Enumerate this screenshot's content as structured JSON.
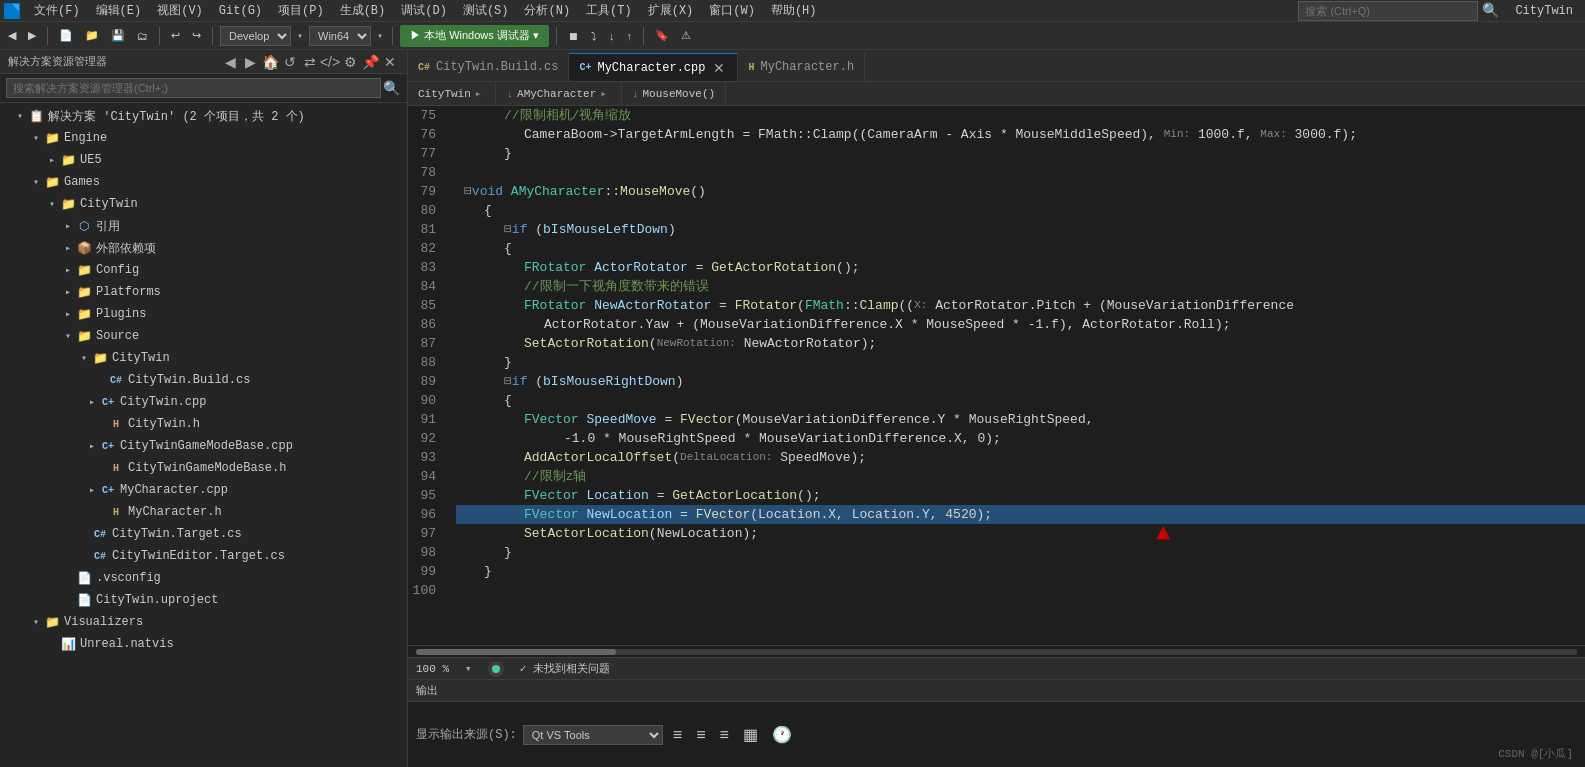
{
  "app": {
    "title": "CityTwin",
    "icon": "VS"
  },
  "menu": {
    "items": [
      "文件(F)",
      "编辑(E)",
      "视图(V)",
      "Git(G)",
      "项目(P)",
      "生成(B)",
      "调试(D)",
      "测试(S)",
      "分析(N)",
      "工具(T)",
      "扩展(X)",
      "窗口(W)",
      "帮助(H)"
    ]
  },
  "toolbar": {
    "config": "Develop▾",
    "platform": "Win64▾",
    "run_label": "▶ 本地 Windows 调试器 ▾",
    "search_placeholder": "搜索 (Ctrl+Q)"
  },
  "sidebar": {
    "title": "解决方案资源管理器",
    "search_placeholder": "搜索解决方案资源管理器(Ctrl+;)",
    "solution_label": "解决方案 'CityTwin' (2 个项目，共 2 个)",
    "tree": [
      {
        "id": "engine",
        "label": "Engine",
        "type": "folder",
        "indent": 1,
        "expanded": true
      },
      {
        "id": "ue5",
        "label": "UE5",
        "type": "folder",
        "indent": 2,
        "expanded": false
      },
      {
        "id": "games",
        "label": "Games",
        "type": "folder",
        "indent": 1,
        "expanded": true
      },
      {
        "id": "citytwin-proj",
        "label": "CityTwin",
        "type": "folder",
        "indent": 2,
        "expanded": true
      },
      {
        "id": "ref",
        "label": "引用",
        "type": "ref",
        "indent": 3,
        "expanded": false
      },
      {
        "id": "extdep",
        "label": "外部依赖项",
        "type": "extdep",
        "indent": 3,
        "expanded": false
      },
      {
        "id": "config",
        "label": "Config",
        "type": "folder",
        "indent": 3,
        "expanded": false
      },
      {
        "id": "platforms",
        "label": "Platforms",
        "type": "folder",
        "indent": 3,
        "expanded": false
      },
      {
        "id": "plugins",
        "label": "Plugins",
        "type": "folder",
        "indent": 3,
        "expanded": false
      },
      {
        "id": "source",
        "label": "Source",
        "type": "folder",
        "indent": 3,
        "expanded": true
      },
      {
        "id": "citytwin-src",
        "label": "CityTwin",
        "type": "folder",
        "indent": 4,
        "expanded": true
      },
      {
        "id": "citytwin-build",
        "label": "CityTwin.Build.cs",
        "type": "cs",
        "indent": 5
      },
      {
        "id": "citytwin-cpp",
        "label": "CityTwin.cpp",
        "type": "cpp-plus",
        "indent": 5
      },
      {
        "id": "citytwin-h",
        "label": "CityTwin.h",
        "type": "h",
        "indent": 5
      },
      {
        "id": "gamemode-cpp",
        "label": "CityTwinGameModeBase.cpp",
        "type": "cpp-plus",
        "indent": 5
      },
      {
        "id": "gamemode-h",
        "label": "CityTwinGameModeBase.h",
        "type": "h",
        "indent": 5
      },
      {
        "id": "mychar-cpp",
        "label": "MyCharacter.cpp",
        "type": "cpp-plus",
        "indent": 5
      },
      {
        "id": "mychar-h",
        "label": "MyCharacter.h",
        "type": "h",
        "indent": 5
      },
      {
        "id": "target",
        "label": "CityTwin.Target.cs",
        "type": "cs",
        "indent": 4
      },
      {
        "id": "editor-target",
        "label": "CityTwinEditor.Target.cs",
        "type": "cs",
        "indent": 4
      },
      {
        "id": "vsconfig",
        "label": ".vsconfig",
        "type": "config",
        "indent": 3
      },
      {
        "id": "uproject",
        "label": "CityTwin.uproject",
        "type": "config",
        "indent": 3
      },
      {
        "id": "visualizers",
        "label": "Visualizers",
        "type": "folder",
        "indent": 1,
        "expanded": true
      },
      {
        "id": "unreal-natvis",
        "label": "Unreal.natvis",
        "type": "natvis",
        "indent": 2
      }
    ]
  },
  "tabs": [
    {
      "id": "build-cs",
      "label": "CityTwin.Build.cs",
      "active": false,
      "closable": false
    },
    {
      "id": "mychar-cpp",
      "label": "MyCharacter.cpp",
      "active": true,
      "closable": true
    },
    {
      "id": "mychar-h",
      "label": "MyCharacter.h",
      "active": false,
      "closable": false
    }
  ],
  "context_bar": {
    "project": "CityTwin",
    "class": "AMyCharacter",
    "method": "MouseMove()"
  },
  "code": {
    "lines": [
      {
        "num": 75,
        "indent": 2,
        "tokens": [
          {
            "t": "//限制相机/视角缩放",
            "c": "comment"
          }
        ]
      },
      {
        "num": 76,
        "indent": 3,
        "tokens": [
          {
            "t": "CameraBoom->TargetArmLength = FMath::Clamp((CameraArm - Axis * MouseMiddleSpeed), ",
            "c": "plain"
          },
          {
            "t": "Min:",
            "c": "param-hint"
          },
          {
            "t": " 1000.f, ",
            "c": "plain"
          },
          {
            "t": "Max:",
            "c": "param-hint"
          },
          {
            "t": " 3000.f);",
            "c": "plain"
          }
        ]
      },
      {
        "num": 77,
        "indent": 2,
        "tokens": [
          {
            "t": "}",
            "c": "punct"
          }
        ]
      },
      {
        "num": 78,
        "indent": 0,
        "tokens": []
      },
      {
        "num": 79,
        "indent": 0,
        "tokens": [
          {
            "t": "⊟",
            "c": "fold"
          },
          {
            "t": "void ",
            "c": "kw"
          },
          {
            "t": "AMyCharacter",
            "c": "type"
          },
          {
            "t": "::",
            "c": "punct"
          },
          {
            "t": "MouseMove",
            "c": "fn"
          },
          {
            "t": "()",
            "c": "punct"
          }
        ]
      },
      {
        "num": 80,
        "indent": 1,
        "tokens": [
          {
            "t": "{",
            "c": "punct"
          }
        ]
      },
      {
        "num": 81,
        "indent": 2,
        "tokens": [
          {
            "t": "⊟",
            "c": "fold"
          },
          {
            "t": "if",
            "c": "kw"
          },
          {
            "t": " (",
            "c": "punct"
          },
          {
            "t": "bIsMouseLeftDown",
            "c": "var"
          },
          {
            "t": ")",
            "c": "punct"
          }
        ]
      },
      {
        "num": 82,
        "indent": 2,
        "tokens": [
          {
            "t": "{",
            "c": "punct"
          }
        ]
      },
      {
        "num": 83,
        "indent": 3,
        "tokens": [
          {
            "t": "FRotator ",
            "c": "type"
          },
          {
            "t": "ActorRotator",
            "c": "var"
          },
          {
            "t": " = ",
            "c": "op"
          },
          {
            "t": "GetActorRotation",
            "c": "fn"
          },
          {
            "t": "();",
            "c": "punct"
          }
        ]
      },
      {
        "num": 84,
        "indent": 3,
        "tokens": [
          {
            "t": "//限制一下视角度数带来的错误",
            "c": "comment"
          }
        ]
      },
      {
        "num": 85,
        "indent": 3,
        "tokens": [
          {
            "t": "FRotator ",
            "c": "type"
          },
          {
            "t": "NewActorRotator",
            "c": "var"
          },
          {
            "t": " = ",
            "c": "op"
          },
          {
            "t": "FRotator",
            "c": "fn"
          },
          {
            "t": "(",
            "c": "punct"
          },
          {
            "t": "FMath",
            "c": "type"
          },
          {
            "t": "::",
            "c": "punct"
          },
          {
            "t": "Clamp",
            "c": "fn"
          },
          {
            "t": "((",
            "c": "punct"
          },
          {
            "t": "X:",
            "c": "param-hint"
          },
          {
            "t": " ActorRotator.Pitch + (MouseVariationDifference",
            "c": "plain"
          }
        ]
      },
      {
        "num": 86,
        "indent": 4,
        "tokens": [
          {
            "t": "ActorRotator.Yaw + (MouseVariationDifference.X * MouseSpeed * -1.f), ActorRotator.Roll);",
            "c": "plain"
          }
        ]
      },
      {
        "num": 87,
        "indent": 3,
        "tokens": [
          {
            "t": "SetActorRotation",
            "c": "fn"
          },
          {
            "t": "(",
            "c": "punct"
          },
          {
            "t": "NewRotation:",
            "c": "param-hint"
          },
          {
            "t": " NewActorRotator);",
            "c": "plain"
          }
        ]
      },
      {
        "num": 88,
        "indent": 2,
        "tokens": [
          {
            "t": "}",
            "c": "punct"
          }
        ]
      },
      {
        "num": 89,
        "indent": 2,
        "tokens": [
          {
            "t": "⊟",
            "c": "fold"
          },
          {
            "t": "if",
            "c": "kw"
          },
          {
            "t": " (",
            "c": "punct"
          },
          {
            "t": "bIsMouseRightDown",
            "c": "var"
          },
          {
            "t": ")",
            "c": "punct"
          }
        ]
      },
      {
        "num": 90,
        "indent": 2,
        "tokens": [
          {
            "t": "{",
            "c": "punct"
          }
        ]
      },
      {
        "num": 91,
        "indent": 3,
        "tokens": [
          {
            "t": "FVector ",
            "c": "type"
          },
          {
            "t": "SpeedMove",
            "c": "var"
          },
          {
            "t": " = ",
            "c": "op"
          },
          {
            "t": "FVector",
            "c": "fn"
          },
          {
            "t": "(MouseVariationDifference.Y * MouseRightSpeed,",
            "c": "plain"
          }
        ]
      },
      {
        "num": 92,
        "indent": 5,
        "tokens": [
          {
            "t": "-1.0 * MouseRightSpeed * MouseVariationDifference.X, 0);",
            "c": "plain"
          }
        ]
      },
      {
        "num": 93,
        "indent": 3,
        "tokens": [
          {
            "t": "AddActorLocalOffset",
            "c": "fn"
          },
          {
            "t": "(",
            "c": "punct"
          },
          {
            "t": "DeltaLocation:",
            "c": "param-hint"
          },
          {
            "t": " SpeedMove);",
            "c": "plain"
          }
        ]
      },
      {
        "num": 94,
        "indent": 3,
        "tokens": [
          {
            "t": "//限制z轴",
            "c": "comment"
          }
        ]
      },
      {
        "num": 95,
        "indent": 3,
        "tokens": [
          {
            "t": "FVector ",
            "c": "type"
          },
          {
            "t": "Location",
            "c": "var"
          },
          {
            "t": " = ",
            "c": "op"
          },
          {
            "t": "GetActorLocation",
            "c": "fn"
          },
          {
            "t": "();",
            "c": "punct"
          }
        ]
      },
      {
        "num": 96,
        "indent": 3,
        "tokens": [
          {
            "t": "FVector ",
            "c": "type"
          },
          {
            "t": "NewLocation",
            "c": "var"
          },
          {
            "t": " = ",
            "c": "op"
          },
          {
            "t": "FVector",
            "c": "fn"
          },
          {
            "t": "(Location.X, Location.Y, 4520);",
            "c": "plain"
          }
        ],
        "highlighted": true
      },
      {
        "num": 97,
        "indent": 3,
        "tokens": [
          {
            "t": "SetActorLocation",
            "c": "fn"
          },
          {
            "t": "(NewLocation);",
            "c": "plain"
          }
        ]
      },
      {
        "num": 98,
        "indent": 2,
        "tokens": [
          {
            "t": "}",
            "c": "punct"
          }
        ]
      },
      {
        "num": 99,
        "indent": 1,
        "tokens": [
          {
            "t": "}",
            "c": "punct"
          }
        ]
      },
      {
        "num": 100,
        "indent": 0,
        "tokens": []
      }
    ]
  },
  "status_bar": {
    "zoom": "100 %",
    "status": "✓ 未找到相关问题",
    "encoding": "CSDN @[小瓜]",
    "output_label": "输出",
    "source_label": "显示输出来源(S):",
    "source_value": "Qt VS Tools"
  }
}
